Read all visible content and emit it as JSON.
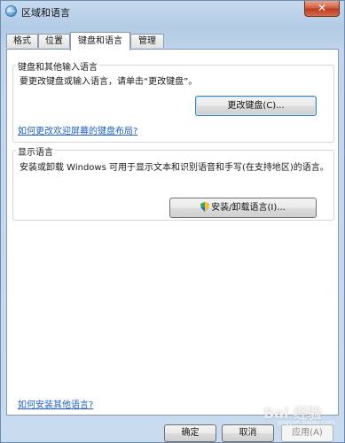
{
  "window": {
    "title": "区域和语言",
    "close_glyph": "✕"
  },
  "tabs": [
    {
      "label": "格式",
      "active": false
    },
    {
      "label": "位置",
      "active": false
    },
    {
      "label": "键盘和语言",
      "active": true
    },
    {
      "label": "管理",
      "active": false
    }
  ],
  "keyboards": {
    "heading": "键盘和其他输入语言",
    "description": "要更改键盘或输入语言，请单击“更改键盘”。",
    "button": "更改键盘(C)...",
    "link": "如何更改欢迎屏幕的键盘布局?"
  },
  "display_language": {
    "heading": "显示语言",
    "description": "安装或卸载 Windows 可用于显示文本和识别语音和手写(在支持地区)的语言。",
    "button": "安装/卸载语言(I)..."
  },
  "help_link": "如何安装其他语言?",
  "footer": {
    "ok": "确定",
    "cancel": "取消",
    "apply": "应用(A)"
  },
  "watermark": {
    "text": "Bai 经验",
    "sub": "jingyan.baidu.com"
  },
  "icons": {
    "window": "globe-icon",
    "uac": "uac-shield-icon"
  }
}
